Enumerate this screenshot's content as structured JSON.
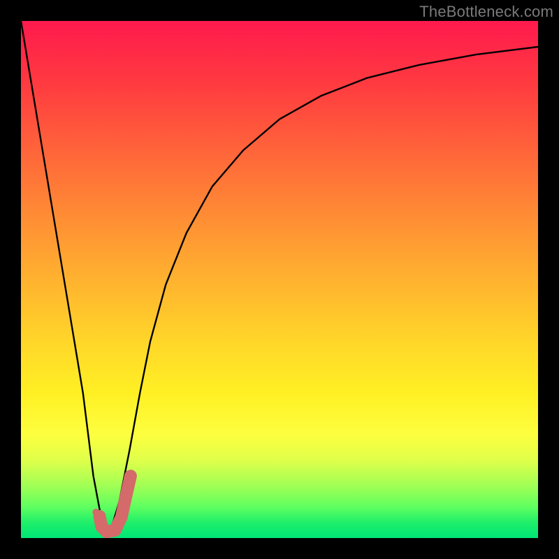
{
  "watermark": "TheBottleneck.com",
  "chart_data": {
    "type": "line",
    "title": "",
    "xlabel": "",
    "ylabel": "",
    "xlim": [
      0,
      100
    ],
    "ylim": [
      0,
      100
    ],
    "grid": false,
    "legend": false,
    "series": [
      {
        "name": "bottleneck-v-curve",
        "x": [
          0,
          3,
          6,
          9,
          12,
          14,
          15.5,
          16.5,
          17.5,
          19,
          21,
          23,
          25,
          28,
          32,
          37,
          43,
          50,
          58,
          67,
          77,
          88,
          100
        ],
        "y": [
          100,
          82,
          64,
          46,
          28,
          12,
          4,
          1,
          2,
          7,
          17,
          28,
          38,
          49,
          59,
          68,
          75,
          81,
          85.5,
          89,
          91.5,
          93.5,
          95
        ]
      }
    ],
    "markers": [
      {
        "name": "dip-point",
        "x": 14.5,
        "y": 5,
        "color": "#d46a6a",
        "size": 10
      }
    ],
    "path_segment": {
      "name": "j-hook",
      "color": "#d46a6a",
      "width": 18,
      "points": [
        {
          "x": 15.2,
          "y": 4.2
        },
        {
          "x": 15.6,
          "y": 2.2
        },
        {
          "x": 16.6,
          "y": 1.2
        },
        {
          "x": 18.2,
          "y": 1.5
        },
        {
          "x": 19.4,
          "y": 4.0
        },
        {
          "x": 20.4,
          "y": 8.5
        },
        {
          "x": 21.2,
          "y": 12.0
        }
      ]
    },
    "gradient_stops": [
      {
        "pos": 0.0,
        "color": "#ff1a4d"
      },
      {
        "pos": 0.25,
        "color": "#ff643a"
      },
      {
        "pos": 0.5,
        "color": "#ffb22f"
      },
      {
        "pos": 0.72,
        "color": "#fff024"
      },
      {
        "pos": 0.9,
        "color": "#9fff55"
      },
      {
        "pos": 1.0,
        "color": "#00e676"
      }
    ]
  }
}
